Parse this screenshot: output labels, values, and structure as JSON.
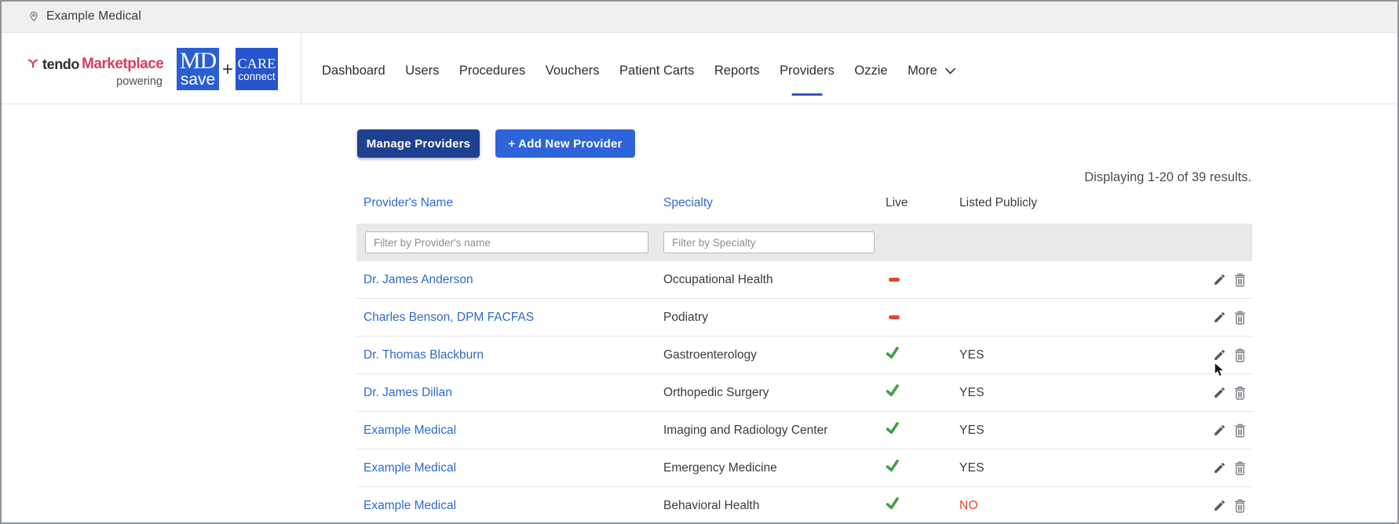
{
  "topbar": {
    "location_label": "Example Medical"
  },
  "brand": {
    "logo_primary": "tendo",
    "logo_secondary": "Marketplace",
    "powering_label": "powering",
    "mdsave_line1": "MD",
    "mdsave_line2": "save",
    "plus_sign": "+",
    "careconnect_line1": "CARE",
    "careconnect_line2": "connect"
  },
  "nav": {
    "items": [
      {
        "label": "Dashboard",
        "active": false
      },
      {
        "label": "Users",
        "active": false
      },
      {
        "label": "Procedures",
        "active": false
      },
      {
        "label": "Vouchers",
        "active": false
      },
      {
        "label": "Patient Carts",
        "active": false
      },
      {
        "label": "Reports",
        "active": false
      },
      {
        "label": "Providers",
        "active": true
      },
      {
        "label": "Ozzie",
        "active": false
      }
    ],
    "more_label": "More"
  },
  "toolbar": {
    "manage_label": "Manage Providers",
    "add_label": "+ Add New Provider"
  },
  "results_summary": "Displaying 1-20 of 39 results.",
  "table": {
    "columns": {
      "name": "Provider's Name",
      "specialty": "Specialty",
      "live": "Live",
      "listed": "Listed Publicly"
    },
    "filters": {
      "name_placeholder": "Filter by Provider's name",
      "specialty_placeholder": "Filter by Specialty"
    },
    "rows": [
      {
        "name": "Dr. James Anderson",
        "specialty": "Occupational Health",
        "live": false,
        "listed": ""
      },
      {
        "name": "Charles Benson, DPM FACFAS",
        "specialty": "Podiatry",
        "live": false,
        "listed": ""
      },
      {
        "name": "Dr. Thomas Blackburn",
        "specialty": "Gastroenterology",
        "live": true,
        "listed": "YES"
      },
      {
        "name": "Dr. James Dillan",
        "specialty": "Orthopedic Surgery",
        "live": true,
        "listed": "YES"
      },
      {
        "name": "Example Medical",
        "specialty": "Imaging and Radiology Center",
        "live": true,
        "listed": "YES"
      },
      {
        "name": "Example Medical",
        "specialty": "Emergency Medicine",
        "live": true,
        "listed": "YES"
      },
      {
        "name": "Example Medical",
        "specialty": "Behavioral Health",
        "live": true,
        "listed": "NO"
      }
    ]
  },
  "colors": {
    "accent_blue": "#2d64da",
    "dark_navy": "#1e4090",
    "link_blue": "#2e6ace",
    "brand_pink": "#d93c62",
    "tile_blue": "#2b5ed5",
    "success_green": "#43a047",
    "danger_red": "#e0472f",
    "active_tab_underline": "#3c52c4"
  }
}
